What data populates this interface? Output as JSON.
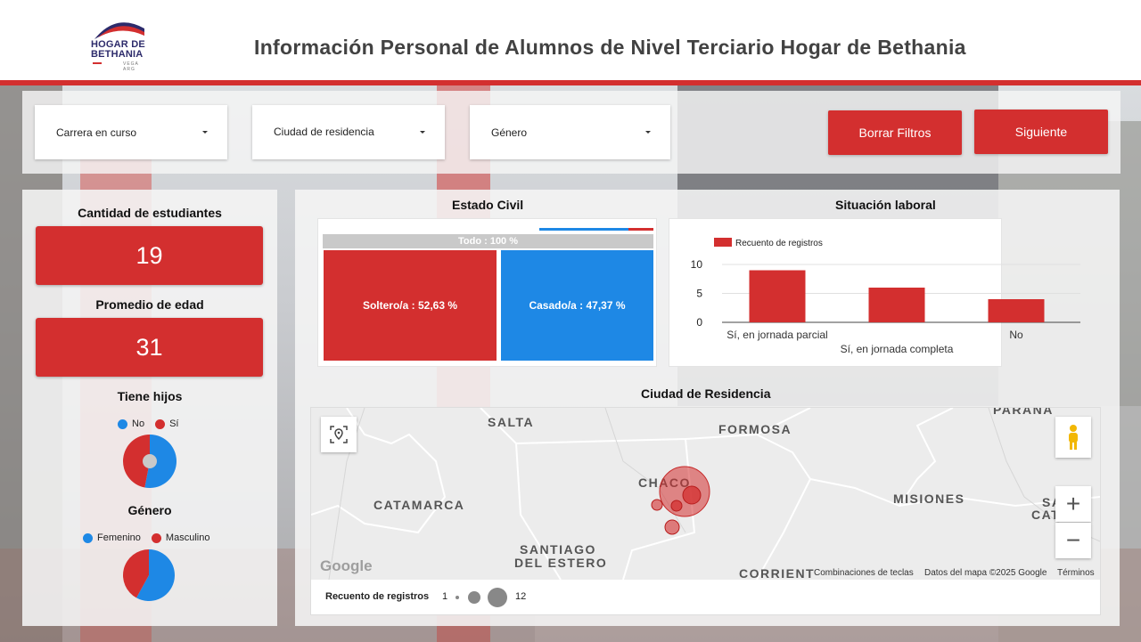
{
  "header": {
    "logo_line1": "HOGAR DE",
    "logo_line2": "BETHANIA",
    "logo_small": "VEGA ARG",
    "title": "Información Personal de Alumnos de Nivel Terciario Hogar de Bethania"
  },
  "filters": {
    "carrera": "Carrera en curso",
    "ciudad": "Ciudad de residencia",
    "genero": "Género",
    "clear_button": "Borrar Filtros",
    "next_button": "Siguiente"
  },
  "kpis": {
    "students_label": "Cantidad de estudiantes",
    "students_value": "19",
    "age_label": "Promedio de edad",
    "age_value": "31"
  },
  "hijos": {
    "title": "Tiene hijos",
    "legend": [
      "No",
      "Sí"
    ],
    "share_no": 0.53
  },
  "genero": {
    "title": "Género",
    "legend": [
      "Femenino",
      "Masculino"
    ],
    "share_femenino": 0.58
  },
  "estado_civil": {
    "title": "Estado Civil",
    "header": "Todo : 100 %",
    "cells": [
      {
        "label": "Soltero/a : 52,63 %",
        "value": 52.63,
        "color": "#d32f2f"
      },
      {
        "label": "Casado/a : 47,37 %",
        "value": 47.37,
        "color": "#1e88e5"
      }
    ]
  },
  "chart_data": {
    "type": "bar",
    "title": "Situación laboral",
    "legend": "Recuento de registros",
    "categories": [
      "Sí, en jornada parcial",
      "Sí, en jornada completa",
      "No"
    ],
    "values": [
      9,
      6,
      4
    ],
    "ylim": [
      0,
      10
    ],
    "yticks": [
      "10",
      "5",
      "0"
    ],
    "color": "#d32f2f"
  },
  "mapa": {
    "title": "Ciudad de Residencia",
    "labels": [
      "SALTA",
      "FORMOSA",
      "CHACO",
      "CATAMARCA",
      "MISIONES",
      "SANTIAGO",
      "DEL ESTERO",
      "CORRIENT",
      "PARANÁ",
      "SA",
      "CATA"
    ],
    "google": "Google",
    "footer": [
      "Combinaciones de teclas",
      "Datos del mapa ©2025 Google",
      "Términos"
    ],
    "legend_title": "Recuento de registros",
    "legend_min": "1",
    "legend_max": "12",
    "zoom_in": "+",
    "zoom_out": "−"
  },
  "colors": {
    "accent": "#d32f2f",
    "blue": "#1e88e5"
  }
}
